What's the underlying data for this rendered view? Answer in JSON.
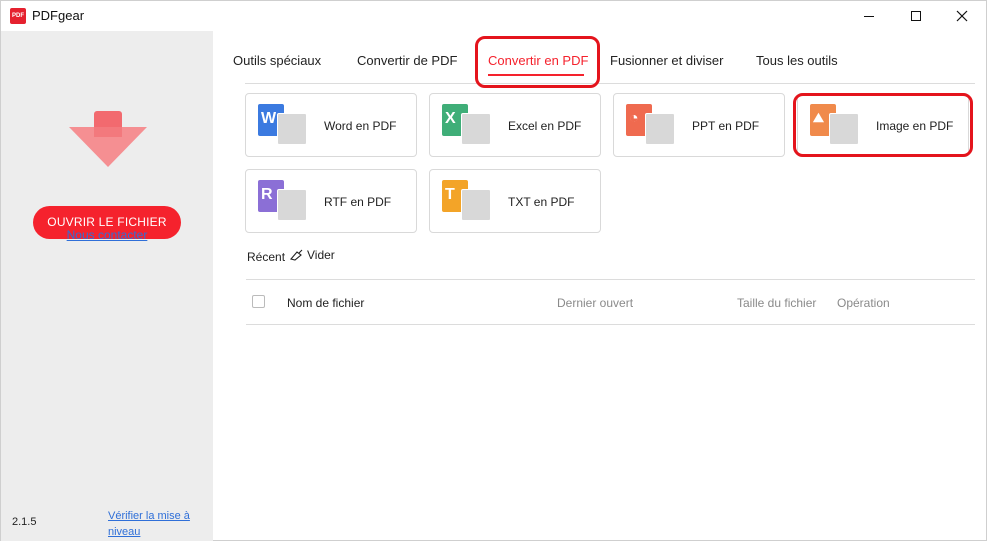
{
  "window": {
    "title": "PDFgear",
    "logo_text": "PDF"
  },
  "sidebar": {
    "open_button": "OUVRIR LE FICHIER",
    "contact_link": "Nous contacter",
    "version": "2.1.5",
    "update_link": "Vérifier la mise à niveau"
  },
  "tabs": [
    {
      "label": "Outils spéciaux",
      "active": false
    },
    {
      "label": "Convertir de PDF",
      "active": false
    },
    {
      "label": "Convertir en PDF",
      "active": true
    },
    {
      "label": "Fusionner et diviser",
      "active": false
    },
    {
      "label": "Tous les outils",
      "active": false
    }
  ],
  "tools": [
    {
      "label": "Word en PDF",
      "letter": "W",
      "color": "#3b7ae0",
      "icon": "word-icon"
    },
    {
      "label": "Excel en PDF",
      "letter": "X",
      "color": "#3fae78",
      "icon": "excel-icon"
    },
    {
      "label": "PPT en PDF",
      "letter": "◔",
      "color": "#ef6a4f",
      "icon": "ppt-icon"
    },
    {
      "label": "Image en PDF",
      "letter": "⛰",
      "color": "#f08a4b",
      "icon": "image-icon"
    },
    {
      "label": "RTF en PDF",
      "letter": "R",
      "color": "#8b6fd6",
      "icon": "rtf-icon"
    },
    {
      "label": "TXT en PDF",
      "letter": "T",
      "color": "#f3a428",
      "icon": "txt-icon"
    }
  ],
  "recent": {
    "label": "Récent",
    "clear": "Vider",
    "columns": {
      "name": "Nom de fichier",
      "last_opened": "Dernier ouvert",
      "size": "Taille du fichier",
      "operation": "Opération"
    },
    "rows": []
  },
  "colors": {
    "accent": "#f5222d",
    "link": "#2f6fd8",
    "highlight": "#e4141c",
    "sidebar_bg": "#ededed"
  }
}
